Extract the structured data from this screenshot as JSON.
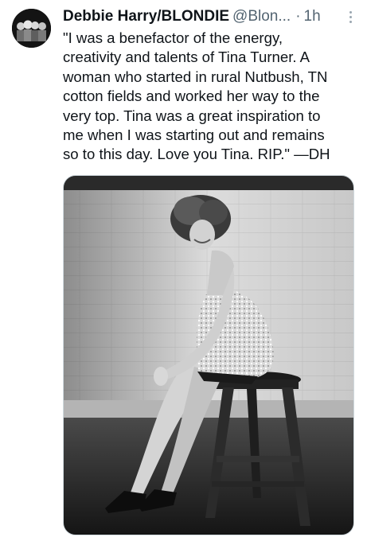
{
  "tweet": {
    "author": {
      "display_name": "Debbie Harry/BLONDIE",
      "handle": "@Blon..."
    },
    "separator": "·",
    "time": "1h",
    "text": "\"I was a benefactor of the energy,\ncreativity and talents of Tina Turner. A\nwoman who started in rural Nutbush, TN\ncotton fields and worked her way to the\nvery top. Tina was a great inspiration to\nme when I was starting out and remains\nso to this day.  Love you Tina. RIP.\" —DH",
    "avatar_icon": "band-photo-avatar",
    "more_icon": "more-options-icon",
    "media": {
      "kind": "black-and-white photo",
      "photo_icon": "tweet-photo"
    }
  }
}
